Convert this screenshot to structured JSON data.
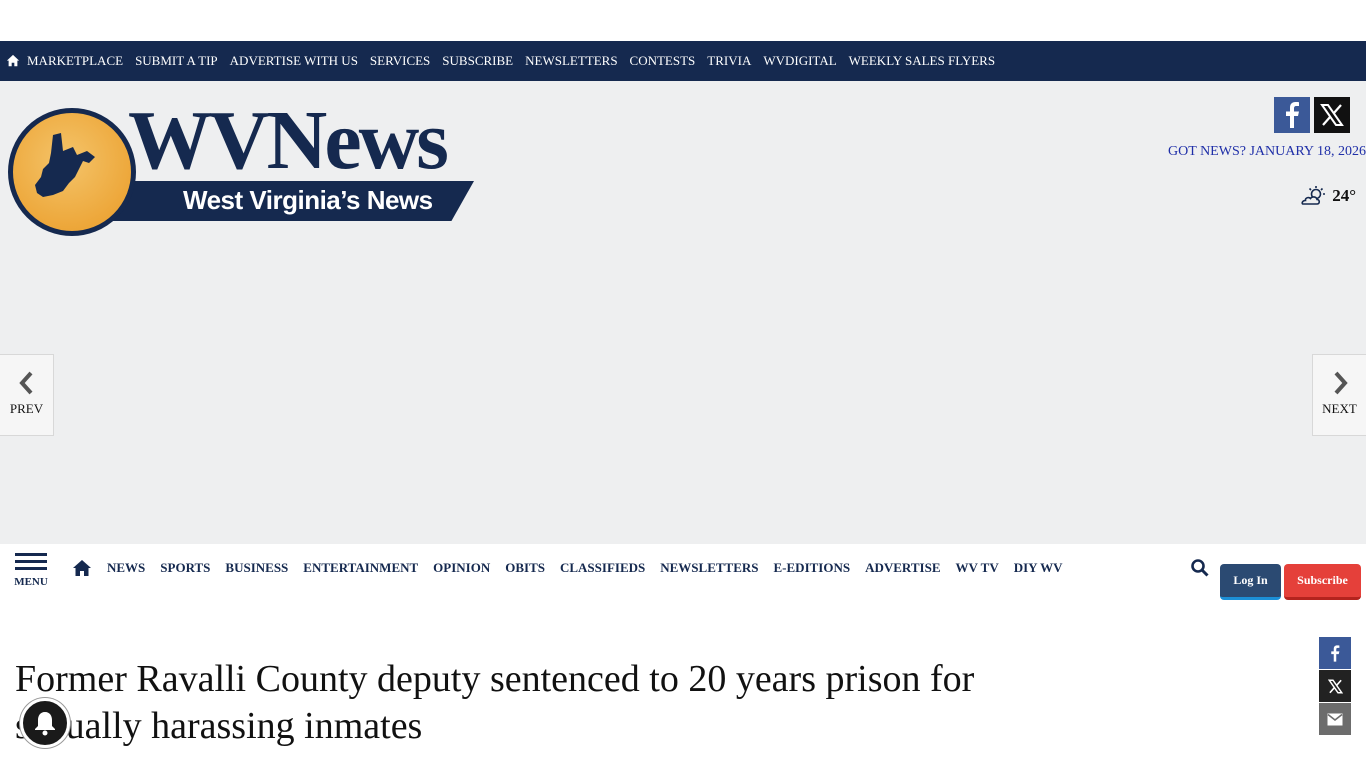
{
  "top_nav": {
    "items": [
      "MARKETPLACE",
      "SUBMIT A TIP",
      "ADVERTISE WITH US",
      "SERVICES",
      "SUBSCRIBE",
      "NEWSLETTERS",
      "CONTESTS",
      "TRIVIA",
      "WVDIGITAL",
      "WEEKLY SALES FLYERS"
    ],
    "home_icon": "home-icon"
  },
  "logo": {
    "name": "WVNews",
    "tagline": "West Virginia’s News"
  },
  "header": {
    "got_news": "GOT NEWS?",
    "date": "JANUARY 18, 2026",
    "weather_temp": "24°",
    "weather_icon": "partly-cloudy-icon"
  },
  "pager": {
    "prev": "PREV",
    "next": "NEXT"
  },
  "main_nav": {
    "menu_label": "MENU",
    "items": [
      "NEWS",
      "SPORTS",
      "BUSINESS",
      "ENTERTAINMENT",
      "OPINION",
      "OBITS",
      "CLASSIFIEDS",
      "NEWSLETTERS",
      "E-EDITIONS",
      "ADVERTISE",
      "WV TV",
      "DIY WV"
    ],
    "login": "Log In",
    "subscribe": "Subscribe"
  },
  "article": {
    "headline": "Former Ravalli County deputy sentenced to 20 years prison for sexually harassing inmates"
  },
  "colors": {
    "navy": "#15294f",
    "accent_orange": "#eda73a",
    "subscribe_red": "#e5403a",
    "facebook": "#3b5998"
  }
}
